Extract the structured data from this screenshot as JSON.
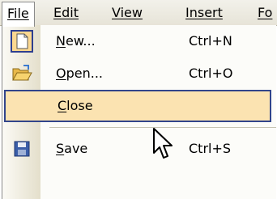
{
  "menubar": {
    "items": [
      {
        "label": "File"
      },
      {
        "label": "Edit"
      },
      {
        "label": "View"
      },
      {
        "label": "Insert"
      },
      {
        "label": "Fo"
      }
    ]
  },
  "file_menu": {
    "items": [
      {
        "label": "New...",
        "shortcut": "Ctrl+N",
        "icon": "new-document-icon"
      },
      {
        "label": "Open...",
        "shortcut": "Ctrl+O",
        "icon": "open-folder-icon"
      },
      {
        "label": "Close",
        "shortcut": "",
        "icon": "",
        "highlighted": true
      },
      {
        "label": "Save",
        "shortcut": "Ctrl+S",
        "icon": "floppy-disk-icon"
      }
    ]
  },
  "colors": {
    "highlight_fill": "#fbe3b1",
    "highlight_border": "#31458c",
    "menubar_bg": "#e9e6da"
  }
}
